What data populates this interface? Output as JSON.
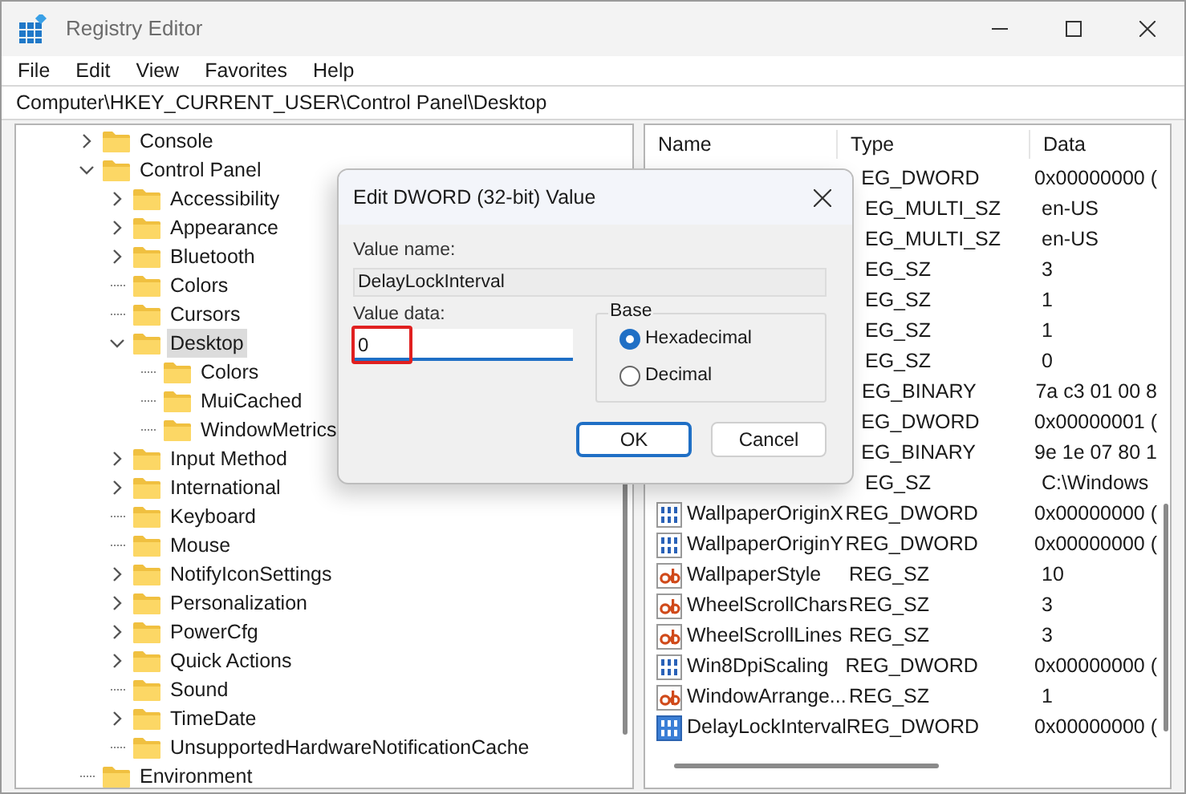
{
  "window": {
    "title": "Registry Editor"
  },
  "menu": [
    "File",
    "Edit",
    "View",
    "Favorites",
    "Help"
  ],
  "address": "Computer\\HKEY_CURRENT_USER\\Control Panel\\Desktop",
  "tree": [
    {
      "label": "Console",
      "kind": "branch",
      "expanded": false,
      "selected": false
    },
    {
      "label": "Control Panel",
      "kind": "branch",
      "expanded": true,
      "selected": false,
      "children": [
        {
          "label": "Accessibility",
          "kind": "branch",
          "expanded": false,
          "selected": false
        },
        {
          "label": "Appearance",
          "kind": "branch",
          "expanded": false,
          "selected": false
        },
        {
          "label": "Bluetooth",
          "kind": "branch",
          "expanded": false,
          "selected": false
        },
        {
          "label": "Colors",
          "kind": "leaf",
          "selected": false
        },
        {
          "label": "Cursors",
          "kind": "leaf",
          "selected": false
        },
        {
          "label": "Desktop",
          "kind": "branch",
          "expanded": true,
          "selected": true,
          "children": [
            {
              "label": "Colors",
              "kind": "leaf",
              "selected": false
            },
            {
              "label": "MuiCached",
              "kind": "leaf",
              "selected": false
            },
            {
              "label": "WindowMetrics",
              "kind": "leaf",
              "selected": false
            }
          ]
        },
        {
          "label": "Input Method",
          "kind": "branch",
          "expanded": false,
          "selected": false
        },
        {
          "label": "International",
          "kind": "branch",
          "expanded": false,
          "selected": false
        },
        {
          "label": "Keyboard",
          "kind": "leaf",
          "selected": false
        },
        {
          "label": "Mouse",
          "kind": "leaf",
          "selected": false
        },
        {
          "label": "NotifyIconSettings",
          "kind": "branch",
          "expanded": false,
          "selected": false
        },
        {
          "label": "Personalization",
          "kind": "branch",
          "expanded": false,
          "selected": false
        },
        {
          "label": "PowerCfg",
          "kind": "branch",
          "expanded": false,
          "selected": false
        },
        {
          "label": "Quick Actions",
          "kind": "branch",
          "expanded": false,
          "selected": false
        },
        {
          "label": "Sound",
          "kind": "leaf",
          "selected": false
        },
        {
          "label": "TimeDate",
          "kind": "branch",
          "expanded": false,
          "selected": false
        },
        {
          "label": "UnsupportedHardwareNotificationCache",
          "kind": "leaf",
          "selected": false
        }
      ]
    },
    {
      "label": "Environment",
      "kind": "leaf",
      "selected": false
    }
  ],
  "list": {
    "columns": [
      "Name",
      "Type",
      "Data"
    ],
    "rows": [
      {
        "type": "EG_DWORD",
        "data": "0x00000000 (",
        "selected": false
      },
      {
        "type": "EG_MULTI_SZ",
        "data": "en-US",
        "selected": false
      },
      {
        "type": "EG_MULTI_SZ",
        "data": "en-US",
        "selected": false
      },
      {
        "type": "EG_SZ",
        "data": "3",
        "selected": false
      },
      {
        "type": "EG_SZ",
        "data": "1",
        "selected": false
      },
      {
        "type": "EG_SZ",
        "data": "1",
        "selected": false
      },
      {
        "type": "EG_SZ",
        "data": "0",
        "selected": false
      },
      {
        "type": "EG_BINARY",
        "data": "7a c3 01 00 8",
        "selected": false
      },
      {
        "type": "EG_DWORD",
        "data": "0x00000001 (",
        "selected": false
      },
      {
        "type": "EG_BINARY",
        "data": "9e 1e 07 80 1",
        "selected": false
      },
      {
        "type": "EG_SZ",
        "data": "C:\\Windows",
        "selected": false
      },
      {
        "name": "WallpaperOriginX",
        "kind": "binary",
        "type": "REG_DWORD",
        "data": "0x00000000 (",
        "selected": false
      },
      {
        "name": "WallpaperOriginY",
        "kind": "binary",
        "type": "REG_DWORD",
        "data": "0x00000000 (",
        "selected": false
      },
      {
        "name": "WallpaperStyle",
        "kind": "string",
        "type": "REG_SZ",
        "data": "10",
        "selected": false
      },
      {
        "name": "WheelScrollChars",
        "kind": "string",
        "type": "REG_SZ",
        "data": "3",
        "selected": false
      },
      {
        "name": "WheelScrollLines",
        "kind": "string",
        "type": "REG_SZ",
        "data": "3",
        "selected": false
      },
      {
        "name": "Win8DpiScaling",
        "kind": "binary",
        "type": "REG_DWORD",
        "data": "0x00000000 (",
        "selected": false
      },
      {
        "name": "WindowArrange...",
        "kind": "string",
        "type": "REG_SZ",
        "data": "1",
        "selected": false
      },
      {
        "name": "DelayLockInterval",
        "kind": "binary",
        "type": "REG_DWORD",
        "data": "0x00000000 (",
        "selected": true
      }
    ]
  },
  "dialog": {
    "title": "Edit DWORD (32-bit) Value",
    "value_name_label": "Value name:",
    "value_name": "DelayLockInterval",
    "value_data_label": "Value data:",
    "value_data": "0",
    "value_data_highlighted": true,
    "base": {
      "label": "Base",
      "options": [
        {
          "label": "Hexadecimal",
          "selected": true
        },
        {
          "label": "Decimal",
          "selected": false
        }
      ]
    },
    "buttons": [
      {
        "label": "OK",
        "default": true
      },
      {
        "label": "Cancel",
        "default": false
      }
    ]
  }
}
